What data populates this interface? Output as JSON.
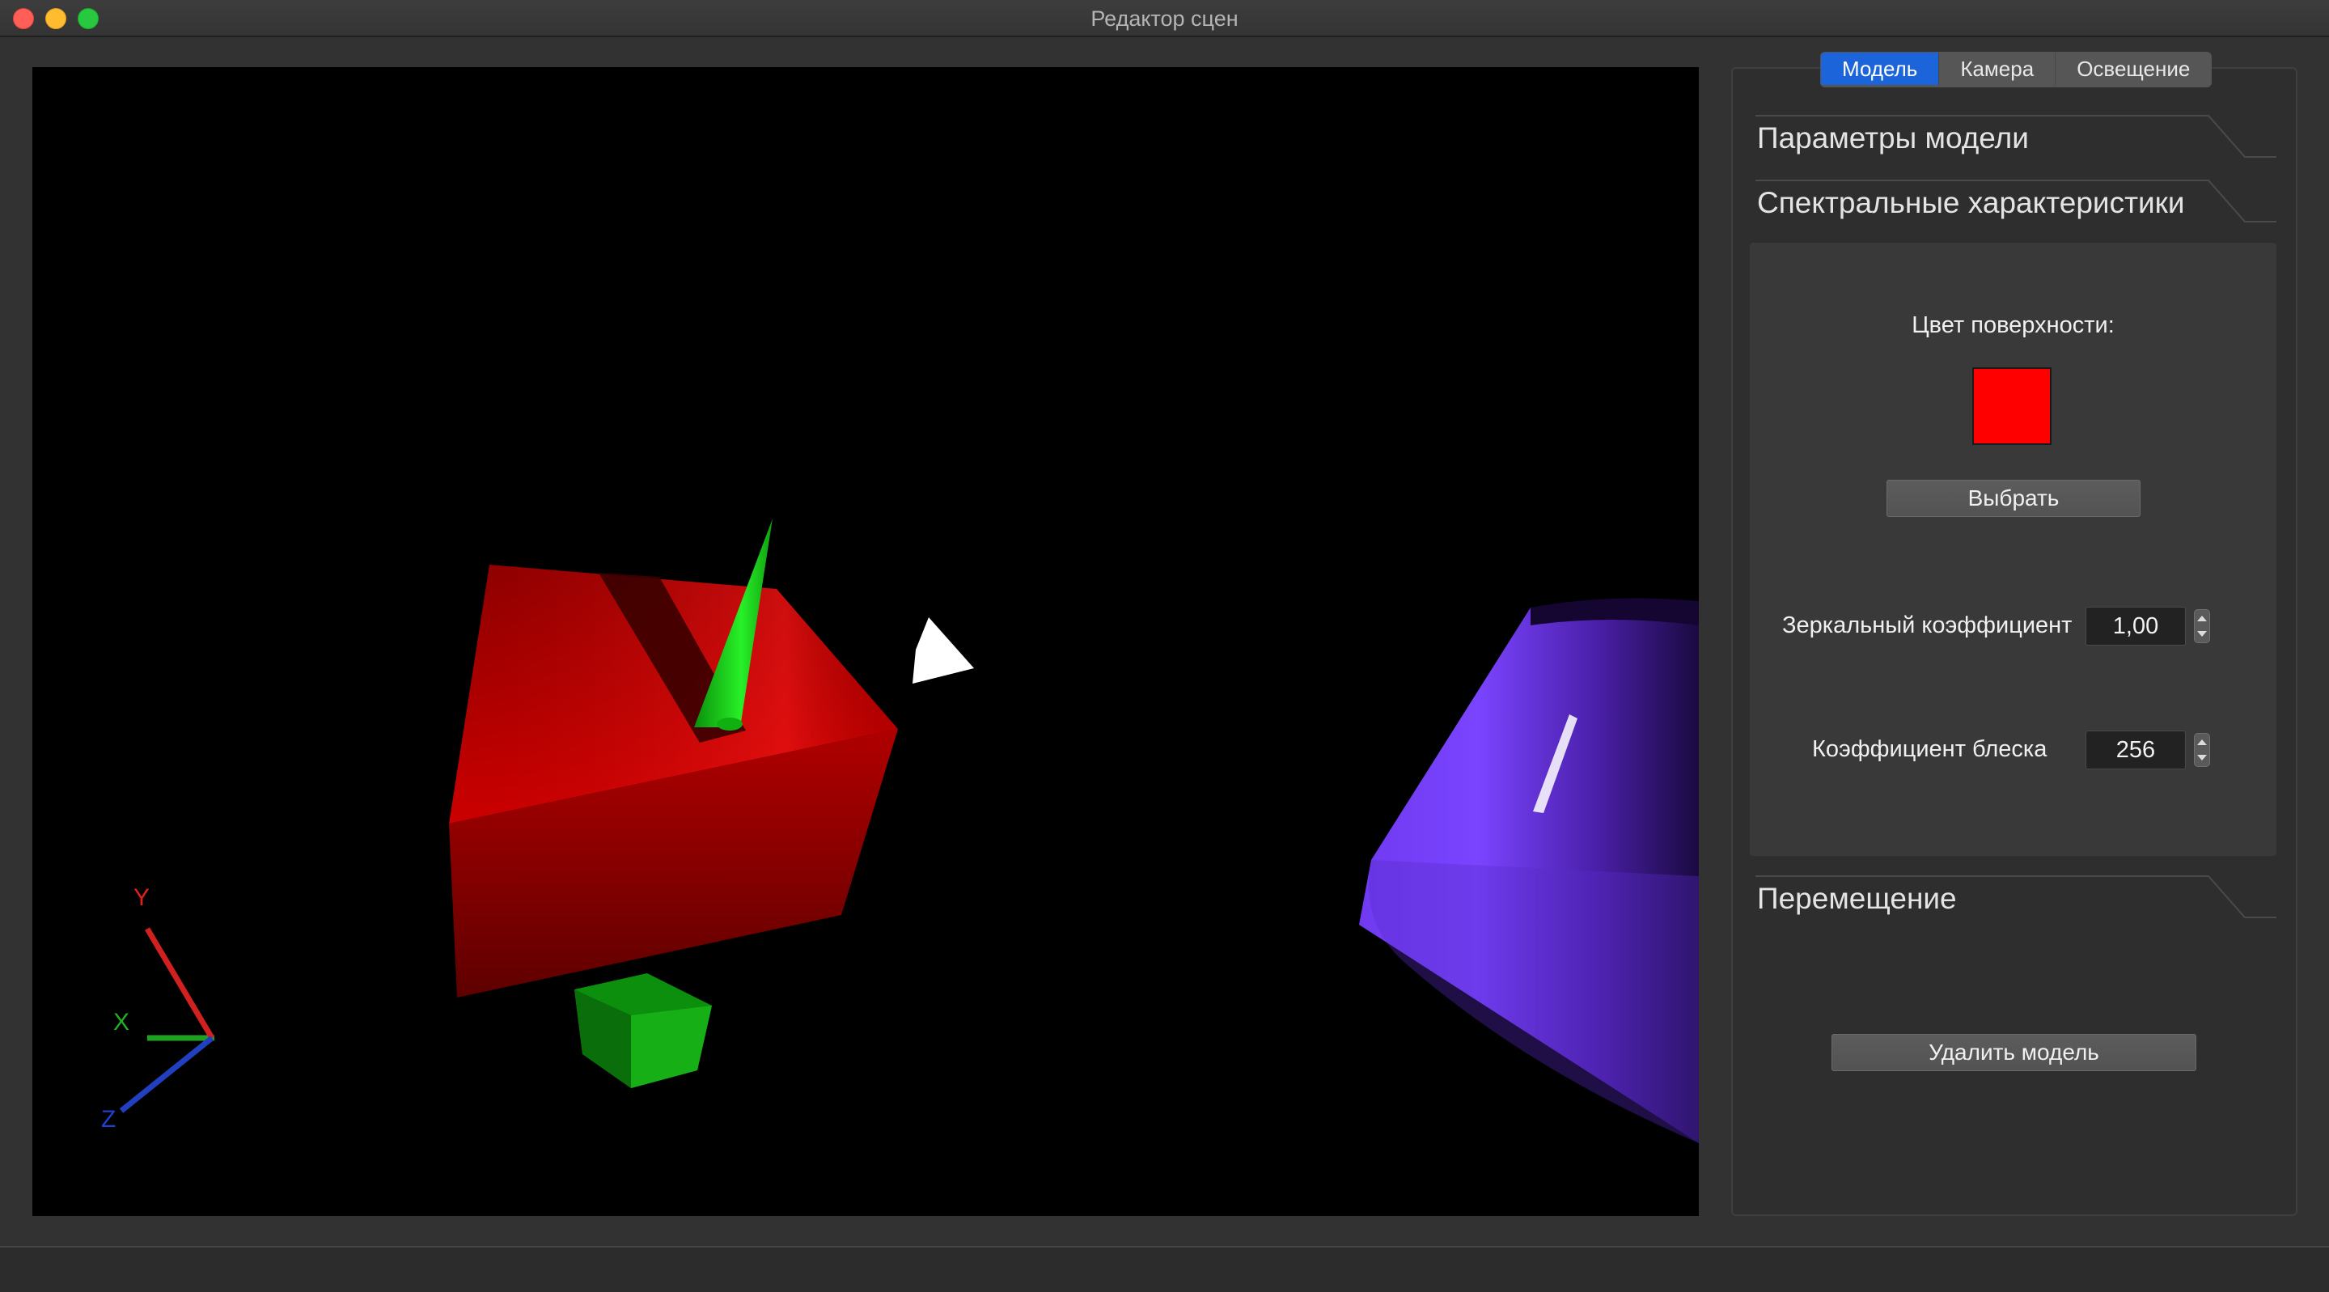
{
  "window": {
    "title": "Редактор сцен"
  },
  "tabs": [
    {
      "label": "Модель",
      "active": true
    },
    {
      "label": "Камера",
      "active": false
    },
    {
      "label": "Освещение",
      "active": false
    }
  ],
  "groups": {
    "model_params": "Параметры модели",
    "spectral": "Спектральные характеристики",
    "movement": "Перемещение"
  },
  "spectral": {
    "surface_color_label": "Цвет поверхности:",
    "surface_color": "#ff0000",
    "choose_button": "Выбрать",
    "specular_label": "Зеркальный коэффициент",
    "specular_value": "1,00",
    "shininess_label": "Коэффициент блеска",
    "shininess_value": "256"
  },
  "actions": {
    "delete_model": "Удалить модель"
  },
  "axes": {
    "x": "X",
    "y": "Y",
    "z": "Z"
  },
  "colors": {
    "accent": "#1b64d9",
    "box": "#c00000",
    "cone": "#14c814",
    "cylinder": "#7a3cff",
    "axis_x": "#22a022",
    "axis_y": "#d02020",
    "axis_z": "#2040c0"
  }
}
